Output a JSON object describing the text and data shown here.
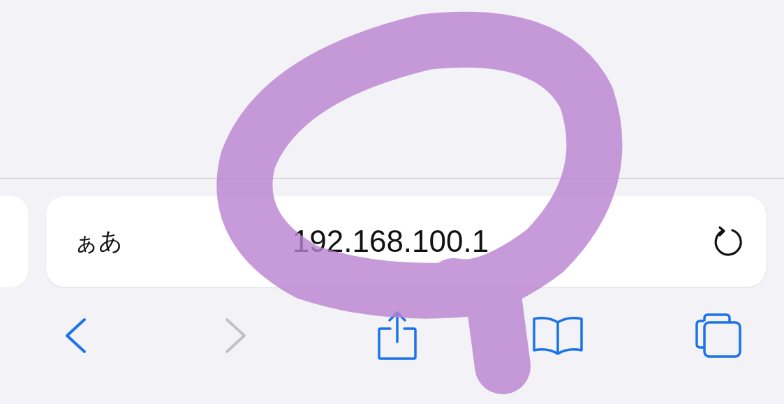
{
  "address_bar": {
    "format_button": "ぁあ",
    "url": "192.168.100.1"
  },
  "toolbar": [
    {
      "kind": "back",
      "disabled": false
    },
    {
      "kind": "forward",
      "disabled": true
    },
    {
      "kind": "share",
      "disabled": false
    },
    {
      "kind": "bookmarks",
      "disabled": false
    },
    {
      "kind": "tabs",
      "disabled": false
    }
  ]
}
